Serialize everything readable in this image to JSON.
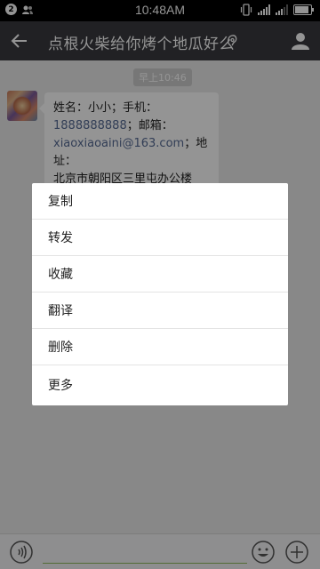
{
  "status_bar": {
    "notification_count": "2",
    "time": "10:48AM"
  },
  "nav": {
    "title": "点根火柴给你烤个地瓜好么"
  },
  "chat": {
    "timestamp": "早上10:46",
    "message": {
      "line1": "姓名：小小；手机：",
      "phone": "1888888888",
      "after_phone": "；邮箱：",
      "email": "xiaoxiaoaini@163.com",
      "after_email": "；地址：",
      "address": "北京市朝阳区三里屯办公楼"
    }
  },
  "context_menu": {
    "items": [
      {
        "label": "复制"
      },
      {
        "label": "转发"
      },
      {
        "label": "收藏"
      },
      {
        "label": "翻译"
      },
      {
        "label": "删除"
      },
      {
        "label": "更多"
      }
    ]
  },
  "colors": {
    "nav_bg": "#393a3f",
    "link": "#576b95",
    "input_underline": "#8fbc5e"
  }
}
